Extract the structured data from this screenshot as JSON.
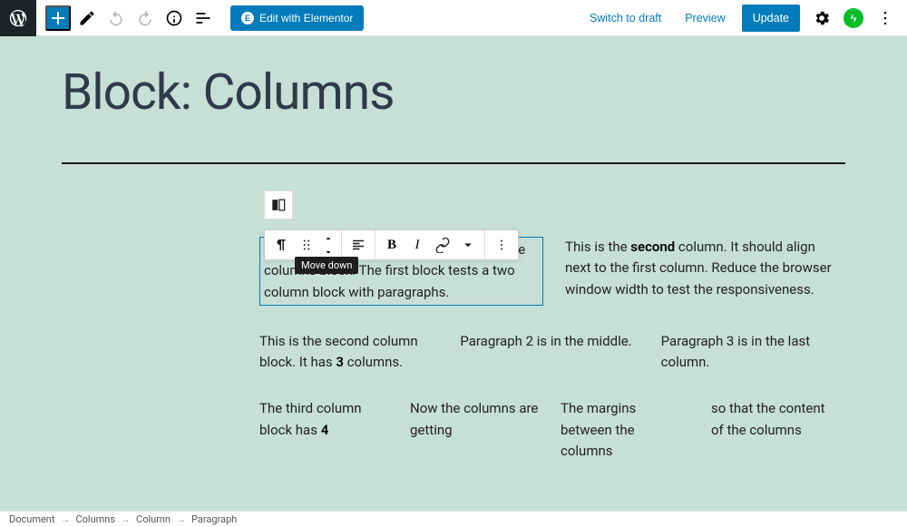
{
  "header": {
    "elementor_label": "Edit with Elementor",
    "switch_to_draft": "Switch to draft",
    "preview": "Preview",
    "update": "Update"
  },
  "page": {
    "title": "Block: Columns"
  },
  "tooltip": "Move down",
  "columns": {
    "two": {
      "col1": "This page tests how the theme displays the columns block. The first block tests a two column block with paragraphs.",
      "col2_a": "This is the ",
      "col2_bold": "second",
      "col2_b": " column. It should align next to the first column. Reduce the browser window width to test the responsiveness."
    },
    "three": {
      "col1_a": "This is the second column block. It has ",
      "col1_bold": "3",
      "col1_b": " columns.",
      "col2": "Paragraph 2 is in the middle.",
      "col3": "Paragraph 3 is in the last column."
    },
    "four": {
      "col1_a": " The third column block has ",
      "col1_bold": "4",
      "col2": "Now the columns are getting",
      "col3": "The margins between the columns",
      "col4": "so that the content of the columns"
    }
  },
  "breadcrumb": [
    "Document",
    "Columns",
    "Column",
    "Paragraph"
  ]
}
